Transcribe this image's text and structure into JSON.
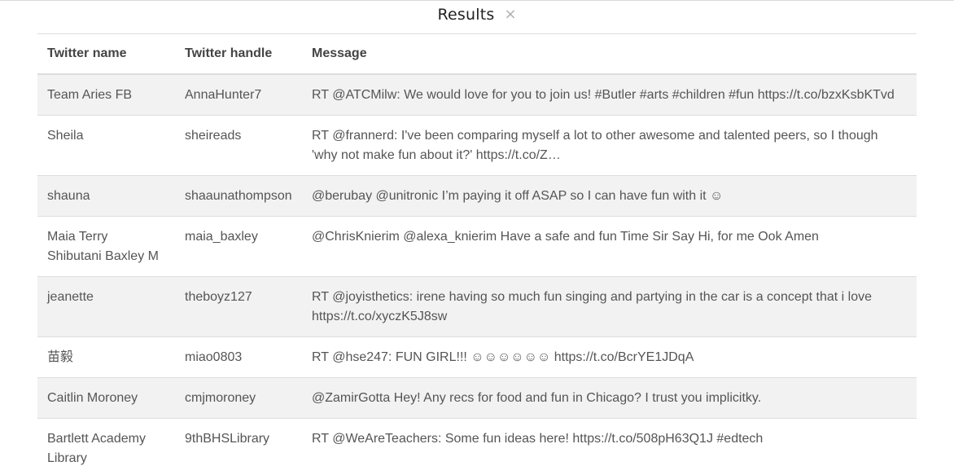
{
  "dialog": {
    "title": "Results",
    "close_glyph": "×"
  },
  "table": {
    "headers": [
      "Twitter name",
      "Twitter handle",
      "Message"
    ],
    "rows": [
      {
        "name": "Team Aries FB",
        "handle": "AnnaHunter7",
        "message": "RT @ATCMilw: We would love for you to join us! #Butler #arts #children #fun https://t.co/bzxKsbKTvd"
      },
      {
        "name": "Sheila",
        "handle": "sheireads",
        "message": "RT @frannerd: I've been comparing myself a lot to other awesome and talented peers, so I though 'why not make fun about it?' https://t.co/Z…"
      },
      {
        "name": "shauna",
        "handle": "shaaunathompson",
        "message": "@berubay @unitronic I’m paying it off ASAP so I can have fun with it ☺"
      },
      {
        "name": "Maia Terry Shibutani Baxley M",
        "handle": "maia_baxley",
        "message": "@ChrisKnierim @alexa_knierim Have a safe and fun Time Sir Say Hi, for me Ook Amen"
      },
      {
        "name": "jeanette",
        "handle": "theboyz127",
        "message": "RT @joyisthetics: irene having so much fun singing and partying in the car is a concept that i love https://t.co/xyczK5J8sw"
      },
      {
        "name": "苗毅",
        "handle": "miao0803",
        "message": "RT @hse247: FUN GIRL!!! ☺☺☺☺☺☺ https://t.co/BcrYE1JDqA"
      },
      {
        "name": "Caitlin Moroney",
        "handle": "cmjmoroney",
        "message": "@ZamirGotta Hey! Any recs for food and fun in Chicago? I trust you implicitky."
      },
      {
        "name": "Bartlett Academy Library",
        "handle": "9thBHSLibrary",
        "message": "RT @WeAreTeachers: Some fun ideas here! https://t.co/508pH63Q1J #edtech"
      }
    ]
  }
}
